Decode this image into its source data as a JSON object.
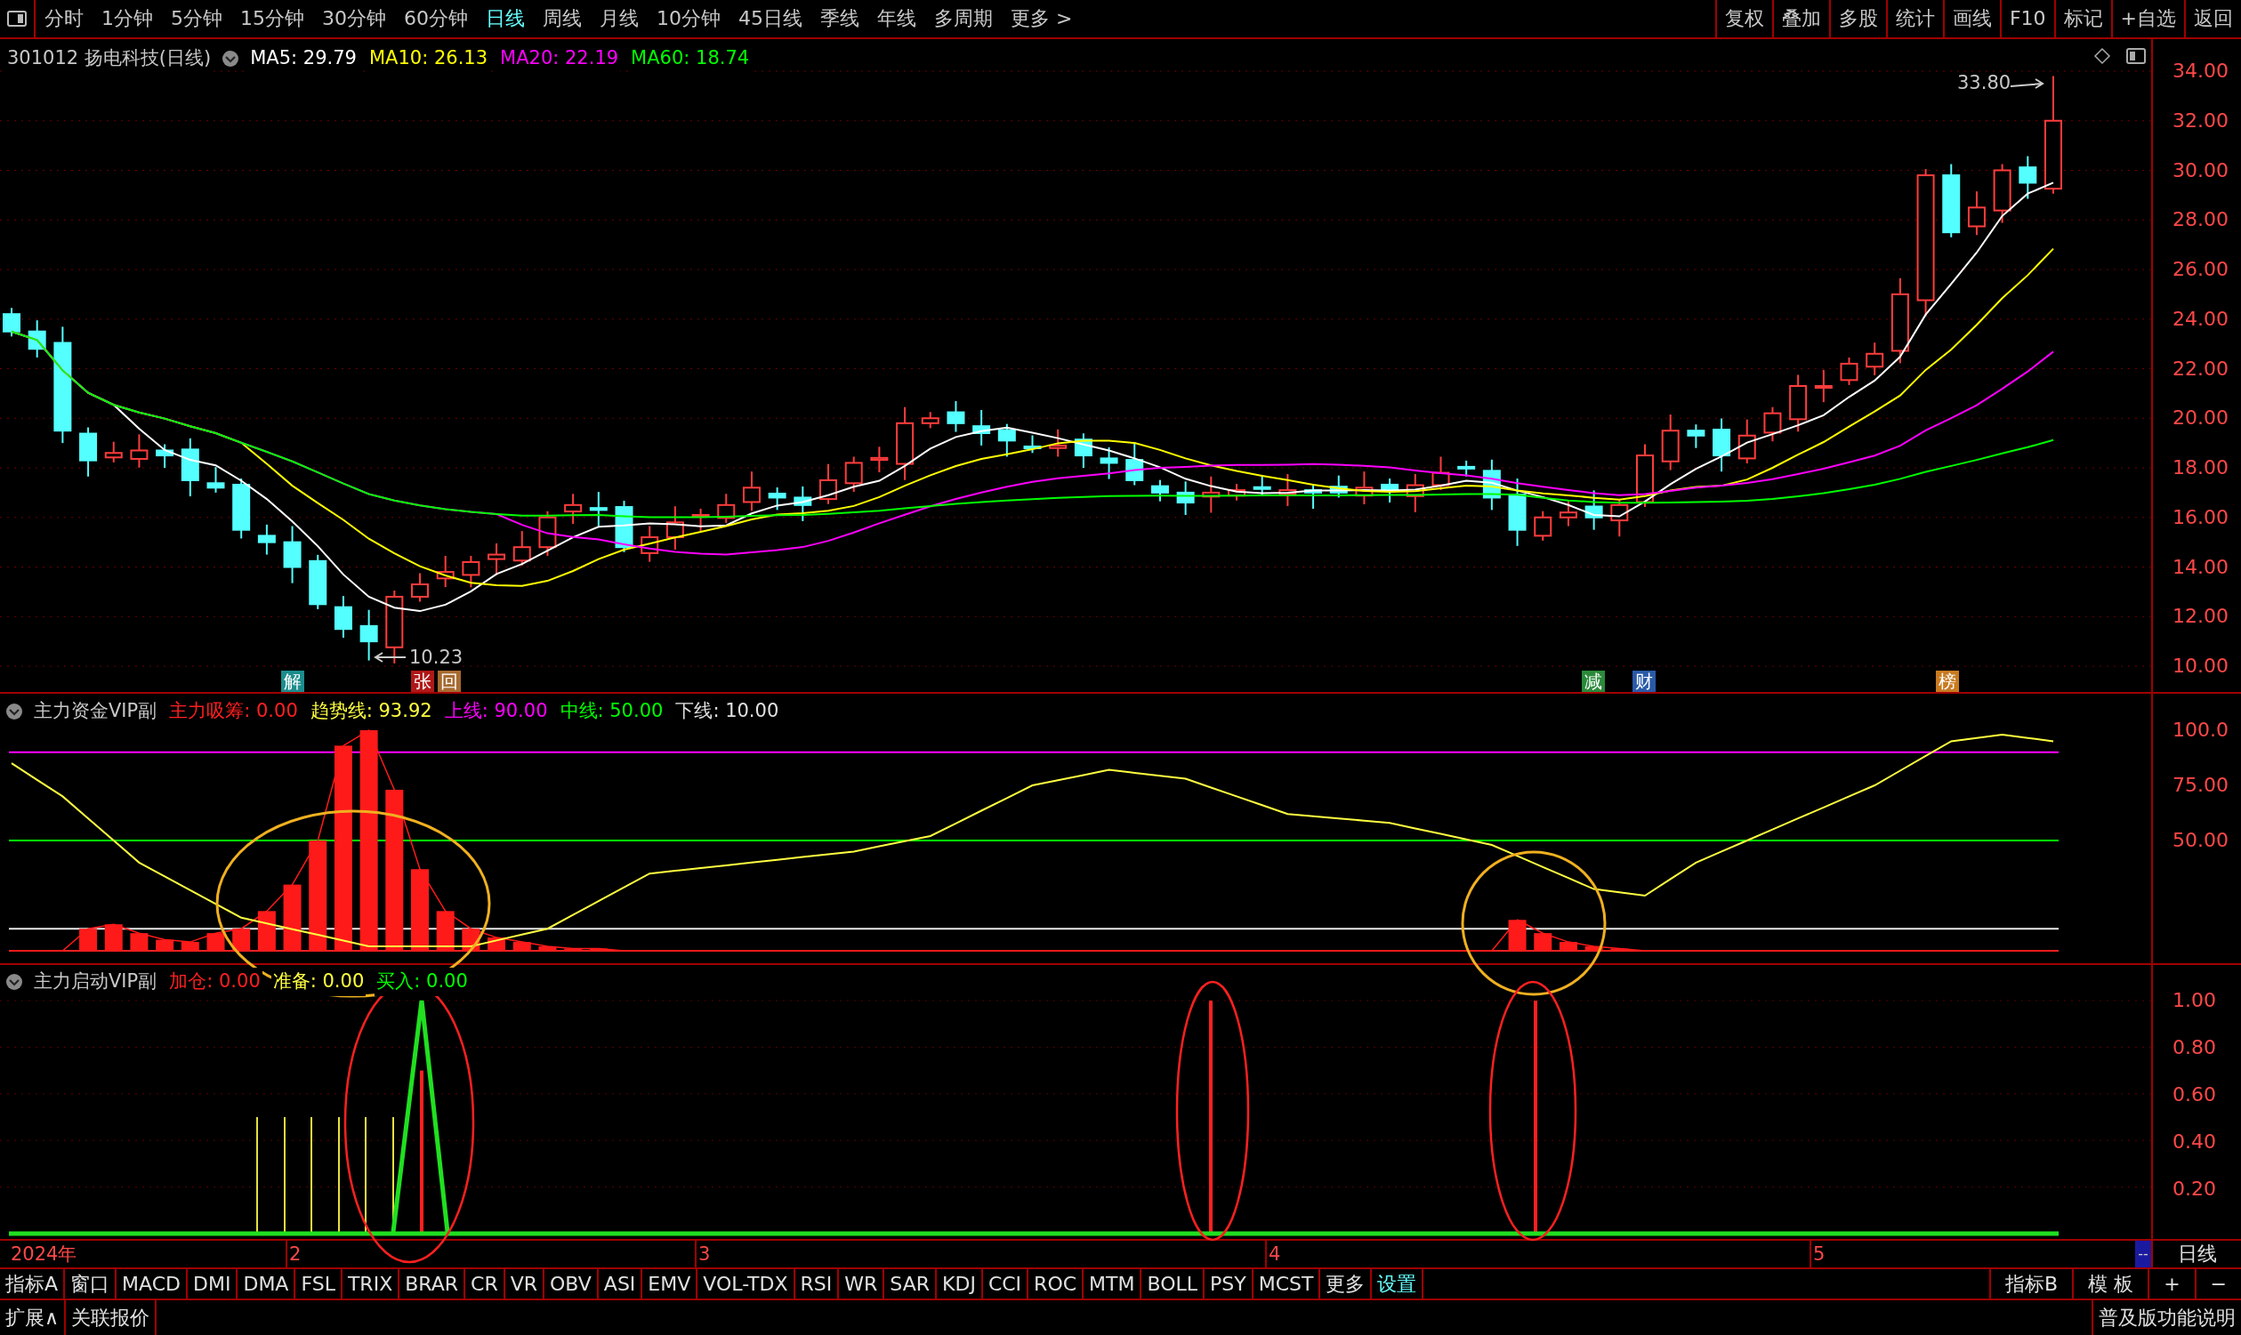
{
  "toolbar": {
    "periods": [
      {
        "label": "分时",
        "selected": false
      },
      {
        "label": "1分钟",
        "selected": false
      },
      {
        "label": "5分钟",
        "selected": false
      },
      {
        "label": "15分钟",
        "selected": false
      },
      {
        "label": "30分钟",
        "selected": false
      },
      {
        "label": "60分钟",
        "selected": false
      },
      {
        "label": "日线",
        "selected": true
      },
      {
        "label": "周线",
        "selected": false
      },
      {
        "label": "月线",
        "selected": false
      },
      {
        "label": "10分钟",
        "selected": false
      },
      {
        "label": "45日线",
        "selected": false
      },
      {
        "label": "季线",
        "selected": false
      },
      {
        "label": "年线",
        "selected": false
      },
      {
        "label": "多周期",
        "selected": false
      },
      {
        "label": "更多 >",
        "selected": false
      }
    ],
    "actions": [
      "复权",
      "叠加",
      "多股",
      "统计",
      "画线",
      "F10",
      "标记",
      "+自选",
      "返回"
    ]
  },
  "price_panel": {
    "stock": "301012 扬电科技(日线)",
    "indicators": [
      {
        "label": "MA5: 29.79",
        "color": "#ffffff"
      },
      {
        "label": "MA10: 26.13",
        "color": "#ffff00"
      },
      {
        "label": "MA20: 22.19",
        "color": "#ff00ff"
      },
      {
        "label": "MA60: 18.74",
        "color": "#00ff00"
      }
    ],
    "axis_ticks": [
      "34.00",
      "32.00",
      "30.00",
      "28.00",
      "26.00",
      "24.00",
      "22.00",
      "20.00",
      "18.00",
      "16.00",
      "14.00",
      "12.00",
      "10.00"
    ],
    "high_label": "33.80",
    "low_label": "10.23",
    "markers": [
      {
        "label": "解",
        "color": "#1c8c8c"
      },
      {
        "label": "张",
        "color": "#b01818"
      },
      {
        "label": "回",
        "color": "#a86a30"
      },
      {
        "label": "减",
        "color": "#2a8a3a"
      },
      {
        "label": "财",
        "color": "#2a5aa8"
      },
      {
        "label": "榜",
        "color": "#c87a20"
      }
    ]
  },
  "fund_panel": {
    "title": "主力资金VIP副",
    "values": [
      {
        "label": "主力吸筹: 0.00",
        "color": "#ff2020"
      },
      {
        "label": "趋势线: 93.92",
        "color": "#ffff40"
      },
      {
        "label": "上线: 90.00",
        "color": "#ff00ff"
      },
      {
        "label": "中线: 50.00",
        "color": "#00ff00"
      },
      {
        "label": "下线: 10.00",
        "color": "#e0e0e0"
      }
    ],
    "axis_ticks": [
      "100.0",
      "75.00",
      "50.00"
    ]
  },
  "start_panel": {
    "title": "主力启动VIP副",
    "values": [
      {
        "label": "加仓: 0.00",
        "color": "#ff2020"
      },
      {
        "label": "准备: 0.00",
        "color": "#ffff40"
      },
      {
        "label": "买入: 0.00",
        "color": "#00ff00"
      }
    ],
    "axis_ticks": [
      "1.00",
      "0.80",
      "0.60",
      "0.40",
      "0.20"
    ]
  },
  "date_axis": {
    "labels": [
      "2024年",
      "2",
      "3",
      "4",
      "5"
    ],
    "scroll_mark": "--",
    "period": "日线"
  },
  "indicator_tabs": [
    {
      "label": "指标A",
      "highlighted": false
    },
    {
      "label": "窗口",
      "highlighted": false
    },
    {
      "label": "MACD",
      "highlighted": false
    },
    {
      "label": "DMI",
      "highlighted": false
    },
    {
      "label": "DMA",
      "highlighted": false
    },
    {
      "label": "FSL",
      "highlighted": false
    },
    {
      "label": "TRIX",
      "highlighted": false
    },
    {
      "label": "BRAR",
      "highlighted": false
    },
    {
      "label": "CR",
      "highlighted": false
    },
    {
      "label": "VR",
      "highlighted": false
    },
    {
      "label": "OBV",
      "highlighted": false
    },
    {
      "label": "ASI",
      "highlighted": false
    },
    {
      "label": "EMV",
      "highlighted": false
    },
    {
      "label": "VOL-TDX",
      "highlighted": false
    },
    {
      "label": "RSI",
      "highlighted": false
    },
    {
      "label": "WR",
      "highlighted": false
    },
    {
      "label": "SAR",
      "highlighted": false
    },
    {
      "label": "KDJ",
      "highlighted": false
    },
    {
      "label": "CCI",
      "highlighted": false
    },
    {
      "label": "ROC",
      "highlighted": false
    },
    {
      "label": "MTM",
      "highlighted": false
    },
    {
      "label": "BOLL",
      "highlighted": false
    },
    {
      "label": "PSY",
      "highlighted": false
    },
    {
      "label": "MCST",
      "highlighted": false
    },
    {
      "label": "更多",
      "highlighted": false
    },
    {
      "label": "设置",
      "highlighted": true
    }
  ],
  "right_tabs": [
    "指标B",
    "模 板",
    "+",
    "−"
  ],
  "footer": {
    "left": [
      "扩展∧",
      "关联报价"
    ],
    "right": "普及版功能说明"
  }
}
